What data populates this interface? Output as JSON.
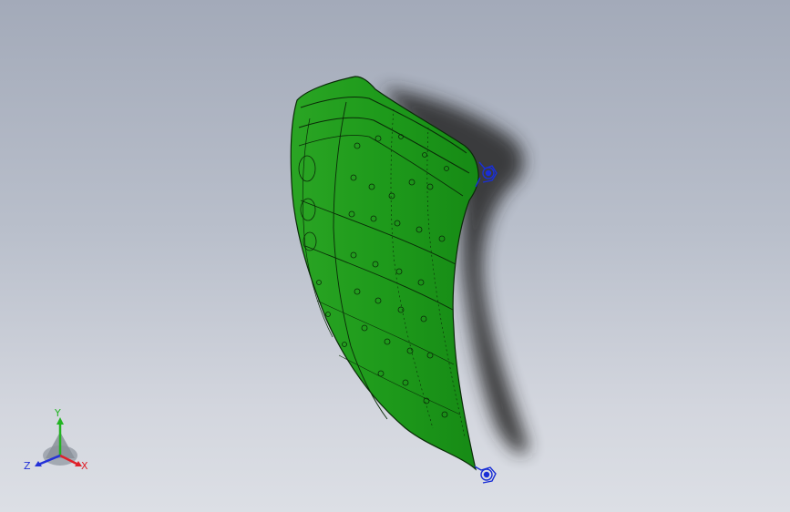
{
  "viewport": {
    "background_top": "#a3aab9",
    "background_bottom": "#dcdfe5"
  },
  "model": {
    "surface_color": "#1f9a1c",
    "edge_color": "#0a2a08",
    "shadow_color": "#2b2b2b",
    "fastener_color": "#1a2fd6"
  },
  "triad": {
    "x_label": "X",
    "y_label": "Y",
    "z_label": "Z",
    "x_color": "#e0202a",
    "y_color": "#22b422",
    "z_color": "#2431d8"
  }
}
